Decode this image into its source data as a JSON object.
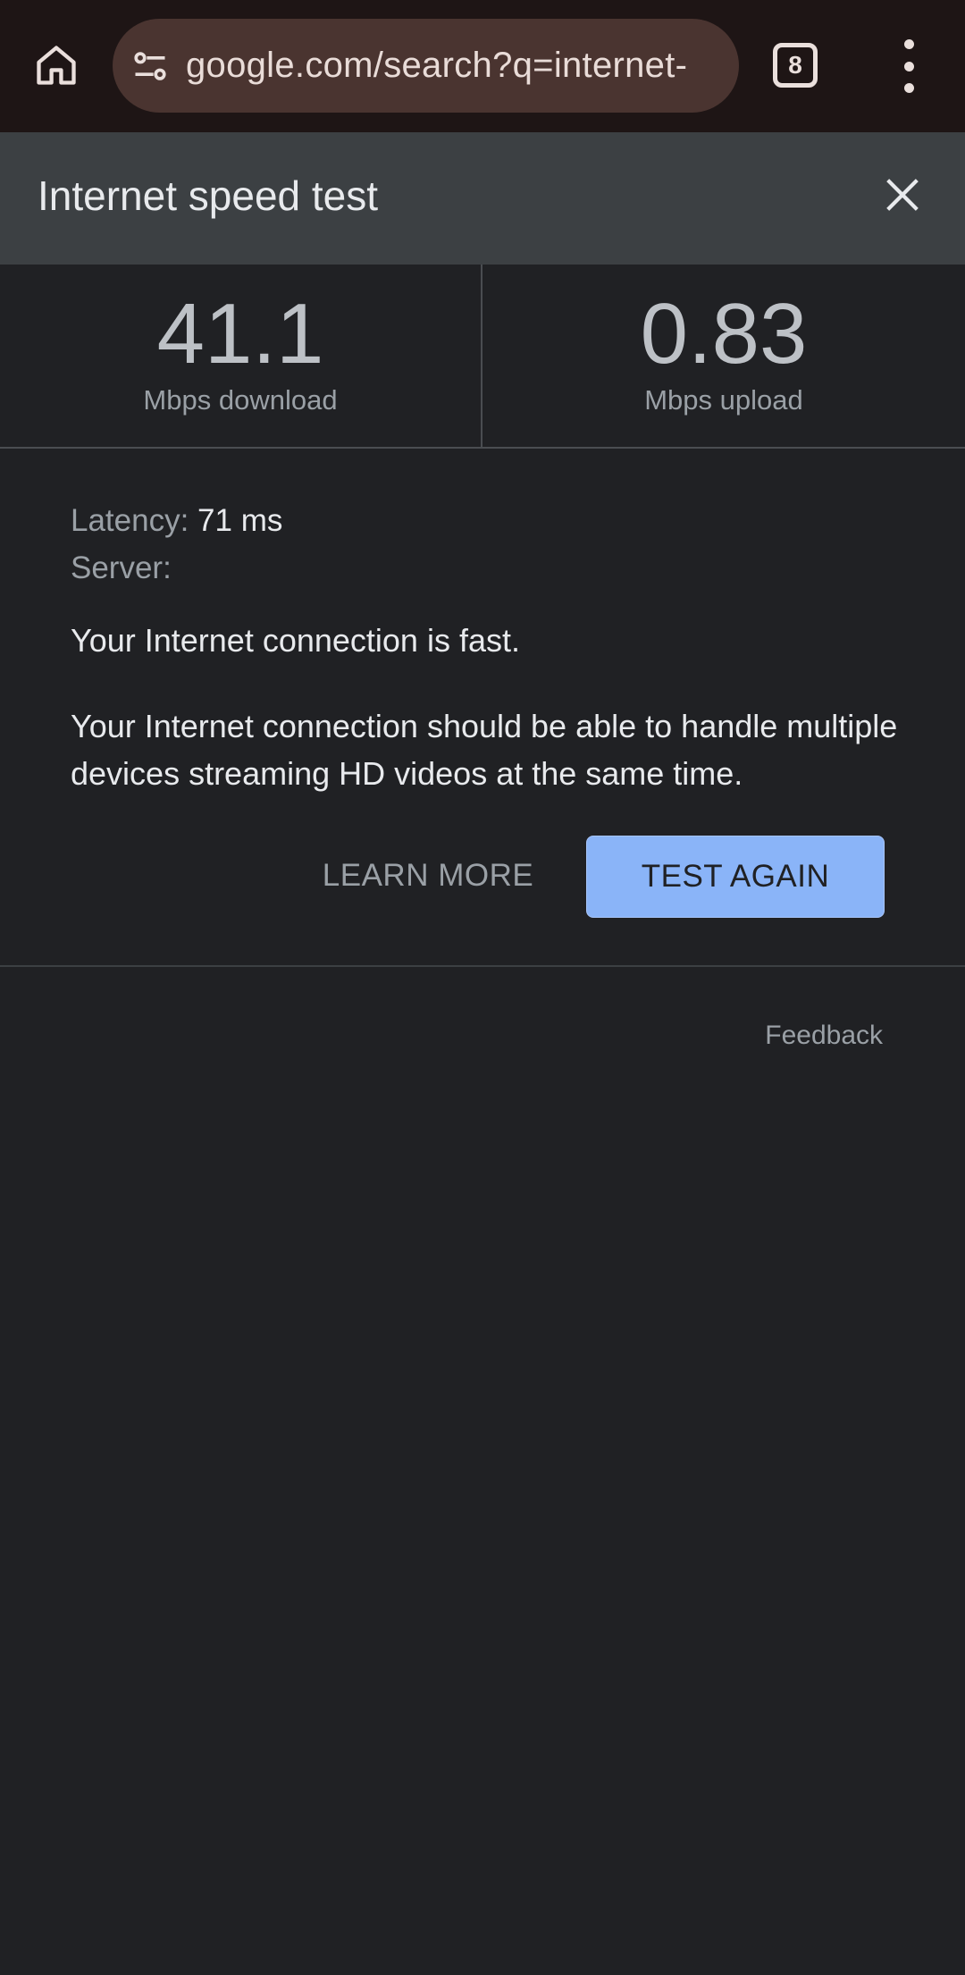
{
  "browser": {
    "url": "google.com/search?q=internet-",
    "tab_count": "8",
    "icons": {
      "home": "home-icon",
      "site_settings": "tune-icon",
      "menu": "more-vert-icon"
    }
  },
  "speedtest": {
    "title": "Internet speed test",
    "download": {
      "value": "41.1",
      "unit": "Mbps download"
    },
    "upload": {
      "value": "0.83",
      "unit": "Mbps upload"
    },
    "latency_label": "Latency:",
    "latency_value": "71 ms",
    "server_label": "Server:",
    "summary": "Your Internet connection is fast.",
    "explanation": "Your Internet connection should be able to handle multiple devices streaming HD videos at the same time.",
    "learn_more_label": "LEARN MORE",
    "test_again_label": "TEST AGAIN",
    "feedback_label": "Feedback"
  },
  "colors": {
    "accent": "#8ab4f8",
    "background": "#202124",
    "header": "#3c4043",
    "topbar": "#1e1515"
  }
}
